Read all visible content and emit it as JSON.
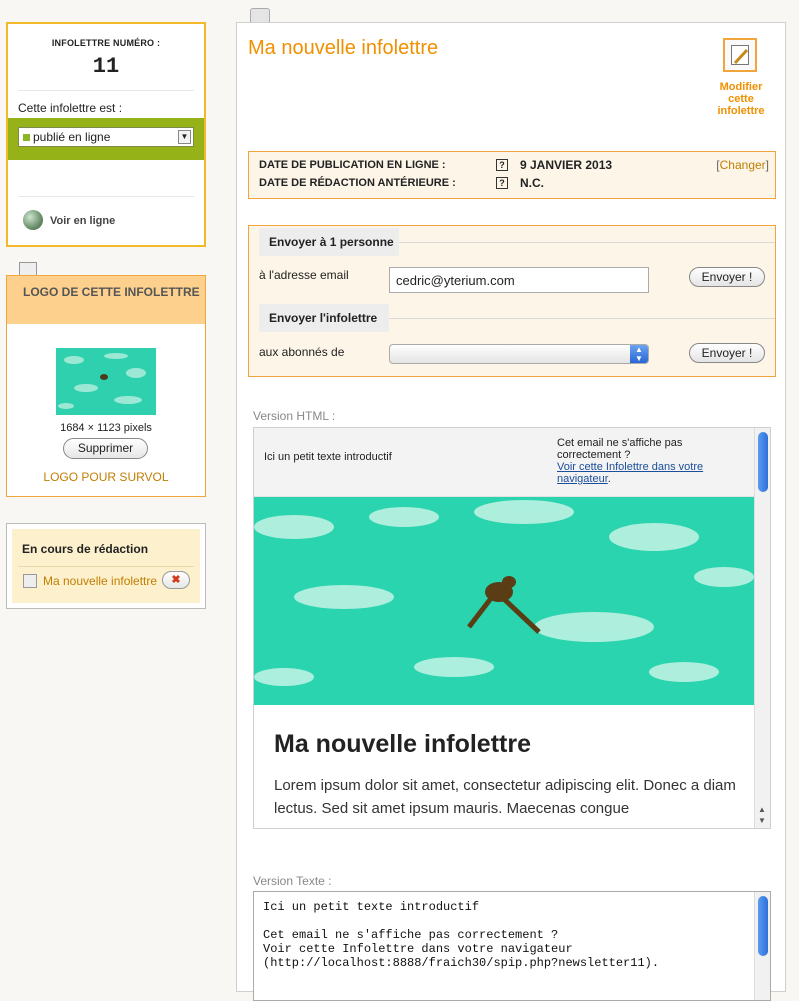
{
  "left": {
    "number_label": "INFOLETTRE NUMÉRO :",
    "number_value": "11",
    "status_label": "Cette infolettre est :",
    "status_value": "publié en ligne",
    "status_color": "#95b318",
    "view_online": "Voir en ligne",
    "logo_header": "LOGO DE CETTE INFOLETTRE",
    "logo_dimensions": "1684 × 1123 pixels",
    "delete_button": "Supprimer",
    "logo_hover": "LOGO POUR SURVOL",
    "drafts_title": "En cours de rédaction",
    "draft_item": "Ma nouvelle infolettre",
    "draft_remove": "✖"
  },
  "main": {
    "title": "Ma nouvelle infolettre",
    "edit_label": "Modifier cette infolettre",
    "dates": {
      "publication_label": "DATE DE PUBLICATION EN LIGNE :",
      "publication_value": "9 JANVIER 2013",
      "redaction_label": "DATE DE RÉDACTION ANTÉRIEURE :",
      "redaction_value": "N.C.",
      "help": "?",
      "change_label": "Changer"
    },
    "send": {
      "one_legend": "Envoyer à 1 personne",
      "email_label": "à l'adresse email",
      "email_value": "cedric@yterium.com",
      "send_button": "Envoyer !",
      "all_legend": "Envoyer l'infolettre",
      "subscribers_label": "aux abonnés de",
      "subscribers_value": ""
    },
    "html_version": {
      "label": "Version HTML :",
      "intro": "Ici un petit texte introductif",
      "notice": "Cet email ne s'affiche pas correctement ?",
      "link": "Voir cette Infolettre dans votre navigateur",
      "link_suffix": ".",
      "heading": "Ma nouvelle infolettre",
      "body": "Lorem ipsum dolor sit amet, consectetur adipiscing elit. Donec a diam lectus. Sed sit amet ipsum mauris. Maecenas congue"
    },
    "text_version": {
      "label": "Version Texte :",
      "content": "Ici un petit texte introductif\n\nCet email ne s'affiche pas correctement ?\nVoir cette Infolettre dans votre navigateur\n(http://localhost:8888/fraich30/spip.php?newsletter11)."
    }
  },
  "colors": {
    "accent_orange": "#f09000",
    "box_border": "#f0a63d",
    "logo_header_bg": "#fdd08d",
    "link_blue": "#1b4e9b"
  }
}
